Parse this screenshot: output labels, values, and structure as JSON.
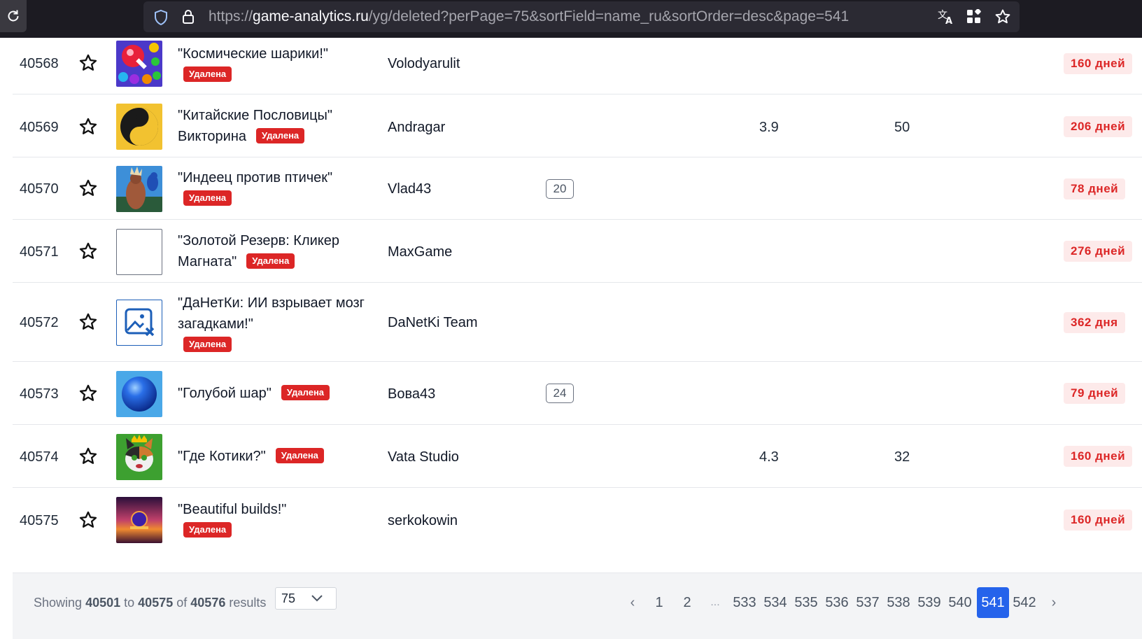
{
  "browser": {
    "url_prefix": "https://",
    "url_host": "game-analytics.ru",
    "url_path": "/yg/deleted?perPage=75&sortField=name_ru&sortOrder=desc&page=541",
    "icons": [
      "reload-icon",
      "shield-icon",
      "lock-icon",
      "translate-icon",
      "extensions-icon",
      "bookmark-star-icon"
    ]
  },
  "table": {
    "rows": [
      {
        "id": "40568",
        "name": "\"Космические шарики!\"",
        "status": "Удалена",
        "developer": "Volodyarulit",
        "count": "",
        "rating": "",
        "votes": "",
        "age": "160 дней",
        "thumb": "balls"
      },
      {
        "id": "40569",
        "name": "\"Китайские Пословицы\" Викторина",
        "status": "Удалена",
        "developer": "Andragar",
        "count": "",
        "rating": "3.9",
        "votes": "50",
        "age": "206 дней",
        "thumb": "yinyang"
      },
      {
        "id": "40570",
        "name": "\"Индеец против птичек\"",
        "status": "Удалена",
        "developer": "Vlad43",
        "count": "20",
        "rating": "",
        "votes": "",
        "age": "78 дней",
        "thumb": "indian"
      },
      {
        "id": "40571",
        "name": "\"Золотой Резерв: Кликер Магната\"",
        "status": "Удалена",
        "developer": "MaxGame",
        "count": "",
        "rating": "",
        "votes": "",
        "age": "276 дней",
        "thumb": "blank"
      },
      {
        "id": "40572",
        "name": "\"ДаНетКи: ИИ взрывает мозг загадками!\"",
        "status": "Удалена",
        "developer": "DaNetKi Team",
        "count": "",
        "rating": "",
        "votes": "",
        "age": "362 дня",
        "thumb": "broken"
      },
      {
        "id": "40573",
        "name": "\"Голубой шар\"",
        "status": "Удалена",
        "developer": "Вова43",
        "count": "24",
        "rating": "",
        "votes": "",
        "age": "79 дней",
        "thumb": "blueball"
      },
      {
        "id": "40574",
        "name": "\"Где Котики?\"",
        "status": "Удалена",
        "developer": "Vata Studio",
        "count": "",
        "rating": "4.3",
        "votes": "32",
        "age": "160 дней",
        "thumb": "cat"
      },
      {
        "id": "40575",
        "name": "\"Beautiful builds!\"",
        "status": "Удалена",
        "developer": "serkokowin",
        "count": "",
        "rating": "",
        "votes": "",
        "age": "160 дней",
        "thumb": "sunset"
      }
    ]
  },
  "footer": {
    "showing_label": "Showing",
    "from": "40501",
    "to_label": "to",
    "to": "40575",
    "of_label": "of",
    "total": "40576",
    "results_label": "results",
    "per_page": "75",
    "pages": [
      "‹",
      "1",
      "2",
      "...",
      "533",
      "534",
      "535",
      "536",
      "537",
      "538",
      "539",
      "540",
      "541",
      "542",
      "›"
    ],
    "current_page": "541"
  },
  "colors": {
    "deleted_badge": "#dc2626",
    "age_text": "#dc2626",
    "age_bg": "#fdeaea",
    "active_page": "#2563eb",
    "browser_bar": "#1c1b22"
  }
}
